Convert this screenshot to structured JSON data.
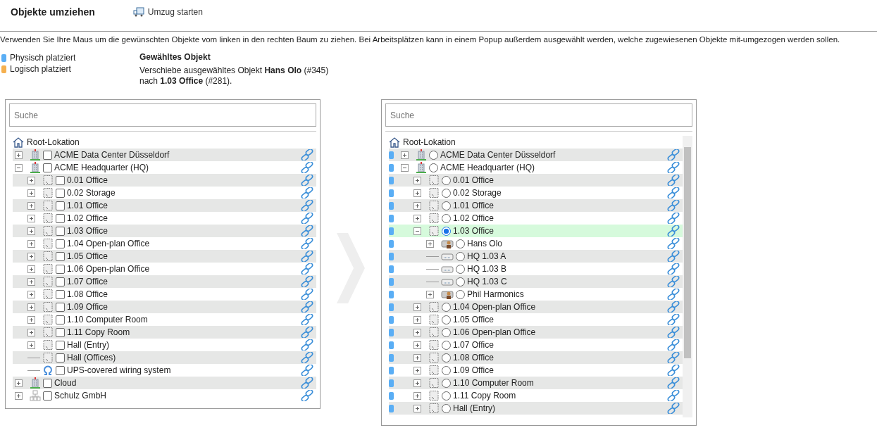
{
  "header": {
    "title": "Objekte umziehen",
    "action": "Umzug starten"
  },
  "description": "Verwenden Sie Ihre Maus um die gewünschten Objekte vom linken in den rechten Baum zu ziehen. Bei Arbeitsplätzen kann in einem Popup außerdem ausgewählt werden, welche zugewiesenen Objekte mit-umgezogen werden sollen.",
  "legend": [
    {
      "label": "Physisch platziert",
      "color": "#5aaef5"
    },
    {
      "label": "Logisch platziert",
      "color": "#f5b04f"
    }
  ],
  "selection": {
    "title": "Gewähltes Objekt",
    "text": "Verschiebe ausgewähltes Objekt **Hans Olo** (#345)",
    "text2": "nach **1.03 Office** (#281)."
  },
  "left_tree": {
    "search": {
      "placeholder": "Suche"
    },
    "root": "Root-Lokation",
    "children": [
      {
        "label": "ACME Data Center Düsseldorf",
        "kind": "site",
        "expanded": false,
        "checked": false
      },
      {
        "label": "ACME Headquarter (HQ)",
        "kind": "site",
        "expanded": true,
        "checked": false,
        "children": [
          {
            "label": "0.01 Office",
            "kind": "room",
            "expanded": false,
            "checked": false
          },
          {
            "label": "0.02 Storage",
            "kind": "room",
            "expanded": false,
            "checked": false
          },
          {
            "label": "1.01 Office",
            "kind": "room",
            "expanded": false,
            "checked": false
          },
          {
            "label": "1.02 Office",
            "kind": "room",
            "expanded": false,
            "checked": false
          },
          {
            "label": "1.03 Office",
            "kind": "room",
            "expanded": false,
            "checked": false
          },
          {
            "label": "1.04 Open-plan Office",
            "kind": "room",
            "expanded": false,
            "checked": false
          },
          {
            "label": "1.05 Office",
            "kind": "room",
            "expanded": false,
            "checked": false
          },
          {
            "label": "1.06 Open-plan Office",
            "kind": "room",
            "expanded": false,
            "checked": false
          },
          {
            "label": "1.07 Office",
            "kind": "room",
            "expanded": false,
            "checked": false
          },
          {
            "label": "1.08 Office",
            "kind": "room",
            "expanded": false,
            "checked": false
          },
          {
            "label": "1.09 Office",
            "kind": "room",
            "expanded": false,
            "checked": false
          },
          {
            "label": "1.10 Computer Room",
            "kind": "room",
            "expanded": false,
            "checked": false
          },
          {
            "label": "1.11 Copy Room",
            "kind": "room",
            "expanded": false,
            "checked": false
          },
          {
            "label": "Hall (Entry)",
            "kind": "room",
            "expanded": false,
            "checked": false
          },
          {
            "label": "Hall (Offices)",
            "kind": "room",
            "checked": false
          },
          {
            "label": "UPS-covered wiring system",
            "kind": "wiring",
            "checked": false
          }
        ]
      },
      {
        "label": "Cloud",
        "kind": "site",
        "expanded": false,
        "checked": false
      },
      {
        "label": "Schulz GmbH",
        "kind": "company",
        "expanded": false,
        "checked": false
      }
    ]
  },
  "right_tree": {
    "search": {
      "placeholder": "Suche"
    },
    "root": "Root-Lokation",
    "children": [
      {
        "label": "ACME Data Center Düsseldorf",
        "kind": "site",
        "expanded": false,
        "selected": false,
        "color": "#5aaef5"
      },
      {
        "label": "ACME Headquarter (HQ)",
        "kind": "site",
        "expanded": true,
        "selected": false,
        "color": "#5aaef5",
        "children": [
          {
            "label": "0.01 Office",
            "kind": "room",
            "expanded": false,
            "selected": false,
            "color": "#5aaef5"
          },
          {
            "label": "0.02 Storage",
            "kind": "room",
            "expanded": false,
            "selected": false,
            "color": "#5aaef5"
          },
          {
            "label": "1.01 Office",
            "kind": "room",
            "expanded": false,
            "selected": false,
            "color": "#5aaef5"
          },
          {
            "label": "1.02 Office",
            "kind": "room",
            "expanded": false,
            "selected": false,
            "color": "#5aaef5"
          },
          {
            "label": "1.03 Office",
            "kind": "room",
            "expanded": true,
            "selected": true,
            "color": "#5aaef5",
            "children": [
              {
                "label": "Hans Olo",
                "kind": "person",
                "expanded": false,
                "selected": false,
                "color": "#5aaef5"
              },
              {
                "label": "HQ 1.03 A",
                "kind": "port",
                "selected": false,
                "color": "#5aaef5"
              },
              {
                "label": "HQ 1.03 B",
                "kind": "port",
                "selected": false,
                "color": "#5aaef5"
              },
              {
                "label": "HQ 1.03 C",
                "kind": "port",
                "selected": false,
                "color": "#5aaef5"
              },
              {
                "label": "Phil Harmonics",
                "kind": "person",
                "expanded": false,
                "selected": false,
                "color": "#5aaef5"
              }
            ]
          },
          {
            "label": "1.04 Open-plan Office",
            "kind": "room",
            "expanded": false,
            "selected": false,
            "color": "#5aaef5"
          },
          {
            "label": "1.05 Office",
            "kind": "room",
            "expanded": false,
            "selected": false,
            "color": "#5aaef5"
          },
          {
            "label": "1.06 Open-plan Office",
            "kind": "room",
            "expanded": false,
            "selected": false,
            "color": "#5aaef5"
          },
          {
            "label": "1.07 Office",
            "kind": "room",
            "expanded": false,
            "selected": false,
            "color": "#5aaef5"
          },
          {
            "label": "1.08 Office",
            "kind": "room",
            "expanded": false,
            "selected": false,
            "color": "#5aaef5"
          },
          {
            "label": "1.09 Office",
            "kind": "room",
            "expanded": false,
            "selected": false,
            "color": "#5aaef5"
          },
          {
            "label": "1.10 Computer Room",
            "kind": "room",
            "expanded": false,
            "selected": false,
            "color": "#5aaef5"
          },
          {
            "label": "1.11 Copy Room",
            "kind": "room",
            "expanded": false,
            "selected": false,
            "color": "#5aaef5"
          },
          {
            "label": "Hall (Entry)",
            "kind": "room",
            "expanded": false,
            "selected": false,
            "color": "#5aaef5"
          }
        ]
      }
    ]
  }
}
